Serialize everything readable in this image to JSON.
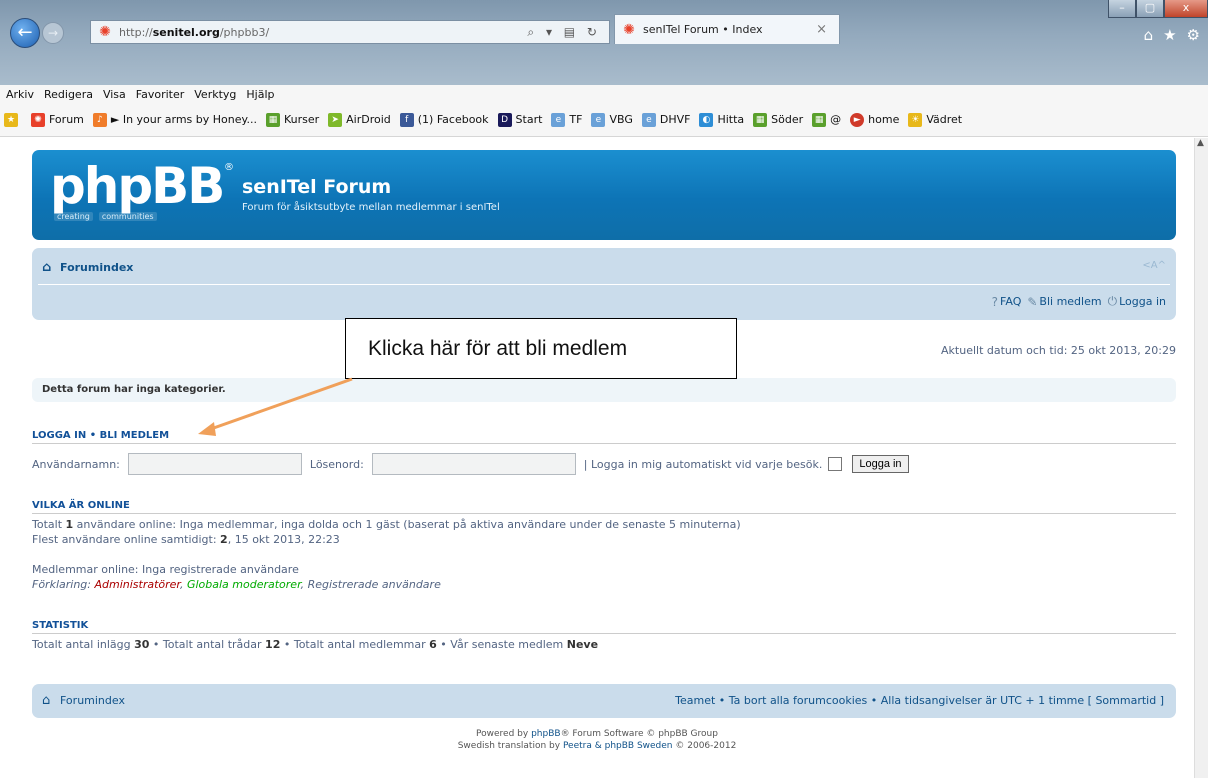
{
  "browser": {
    "address_url_prefix": "http://",
    "address_url_host": "senitel.org",
    "address_url_path": "/phpbb3/",
    "address_tools": "⌕ ▾ ▤ ↻",
    "tab_title": "senITel Forum • Index",
    "tab_close": "×",
    "win_min": "–",
    "win_max": "▢",
    "win_close": "x",
    "nav_back": "←",
    "nav_fwd": "→",
    "right_icons": [
      "⌂",
      "★",
      "⚙"
    ],
    "menu": [
      "Arkiv",
      "Redigera",
      "Visa",
      "Favoriter",
      "Verktyg",
      "Hjälp"
    ],
    "favorites": [
      {
        "label": "Forum",
        "icon": "forum-icon",
        "color": "#e8402a"
      },
      {
        "label": "► In your arms by Honey...",
        "icon": "music-icon",
        "color": "#f07c2a"
      },
      {
        "label": "Kurser",
        "icon": "folder-icon",
        "color": "#5aa02c"
      },
      {
        "label": "AirDroid",
        "icon": "airdroid-icon",
        "color": "#7fb92a"
      },
      {
        "label": "(1) Facebook",
        "icon": "facebook-icon",
        "color": "#3b5998"
      },
      {
        "label": "Start",
        "icon": "dn-icon",
        "color": "#1a1a5a"
      },
      {
        "label": "TF",
        "icon": "page-icon",
        "color": "#6aa1d8"
      },
      {
        "label": "VBG",
        "icon": "page-icon",
        "color": "#6aa1d8"
      },
      {
        "label": "DHVF",
        "icon": "page-icon",
        "color": "#6aa1d8"
      },
      {
        "label": "Hitta",
        "icon": "globe-icon",
        "color": "#2e8ed6"
      },
      {
        "label": "Söder",
        "icon": "folder-icon",
        "color": "#5aa02c"
      },
      {
        "label": "@",
        "icon": "folder-icon",
        "color": "#5aa02c"
      },
      {
        "label": "home",
        "icon": "home-icon",
        "color": "#d03a2a"
      },
      {
        "label": "Vädret",
        "icon": "weather-icon",
        "color": "#e8b81a"
      }
    ]
  },
  "forum": {
    "logo_text": "phpBB",
    "logo_reg": "®",
    "logo_sub_1": "creating",
    "logo_sub_2": "communities",
    "title": "senITel Forum",
    "description": "Forum för åsiktsutbyte mellan medlemmar i senITel",
    "breadcrumb": "Forumindex",
    "resize_glyph": "<A^",
    "nav_links": {
      "faq": "FAQ",
      "register": "Bli medlem",
      "login": "Logga in"
    },
    "datetime": "Aktuellt datum och tid: 25 okt 2013, 20:29",
    "no_categories": "Detta forum har inga kategorier.",
    "login_section": "LOGGA IN  •  BLI MEDLEM",
    "username_label": "Användarnamn:",
    "password_label": "Lösenord:",
    "username_value": "",
    "password_value": "",
    "autologin_label": "| Logga in mig automatiskt vid varje besök.",
    "login_button": "Logga in",
    "online_section": "VILKA ÄR ONLINE",
    "online_line_1_pre": "Totalt ",
    "online_count": "1",
    "online_line_1_mid": " användare online: Inga medlemmar, inga dolda och ",
    "online_guests": "1",
    "online_line_1_post": " gäst (baserat på aktiva användare under de senaste 5 minuterna)",
    "online_line_2_pre": "Flest användare online samtidigt: ",
    "online_max": "2",
    "online_line_2_post": ", 15 okt 2013, 22:23",
    "members_online": "Medlemmar online: Inga registrerade användare",
    "legend_pre": "Förklaring: ",
    "legend_admin": "Administratörer",
    "legend_gmod": "Globala moderatorer",
    "legend_reg": "Registrerade användare",
    "stats_section": "STATISTIK",
    "stats_posts_label": "Totalt antal inlägg ",
    "stats_posts": "30",
    "stats_topics_label": " • Totalt antal trådar ",
    "stats_topics": "12",
    "stats_members_label": " • Totalt antal medlemmar ",
    "stats_members": "6",
    "stats_newest_label": " • Vår senaste medlem ",
    "stats_newest": "Neve",
    "footer_left": "Forumindex",
    "footer_right": "Teamet • Ta bort alla forumcookies • Alla tidsangivelser är UTC + 1 timme [ Sommartid ]",
    "powered_1_pre": "Powered by ",
    "powered_1_link": "phpBB",
    "powered_1_post": "® Forum Software © phpBB Group",
    "powered_2_pre": "Swedish translation by ",
    "powered_2_link": "Peetra & phpBB Sweden",
    "powered_2_post": " © 2006-2012"
  },
  "annotation": {
    "text": "Klicka här för att bli medlem",
    "arrow_color": "#f0a05a"
  }
}
